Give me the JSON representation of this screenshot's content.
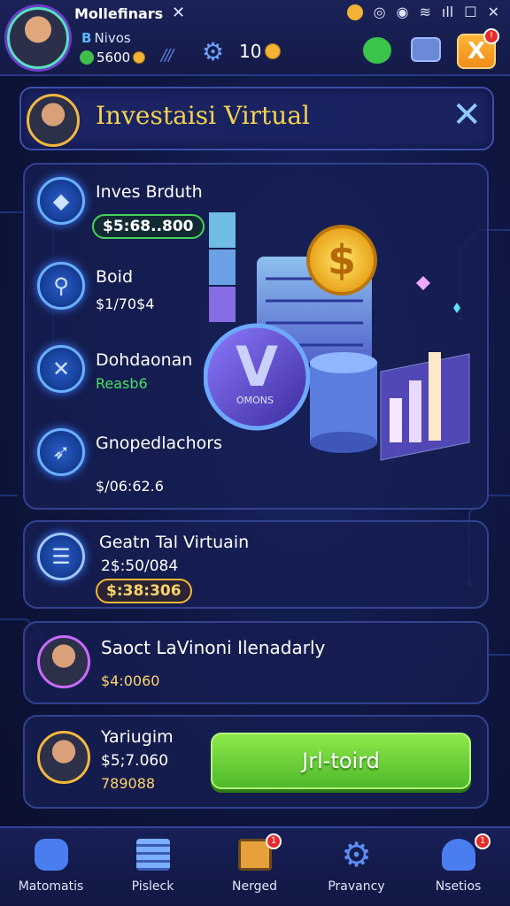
{
  "topbar": {
    "title": "Mollefinars",
    "close": "✕",
    "subtitle_prefix": "B",
    "subtitle": "Nivos",
    "money": "5600",
    "count": "10",
    "gift_label": "X",
    "gift_badge": "!"
  },
  "header": {
    "title": "Investaisi Virtual",
    "close": "✕"
  },
  "investments": [
    {
      "name": "Inves Brduth",
      "value": "$5:68..800",
      "style": "pill-green"
    },
    {
      "name": "Boid",
      "value": "$1/70$4",
      "style": "plain"
    },
    {
      "name": "Dohdaonan",
      "value": "Reasb6",
      "style": "green"
    },
    {
      "name": "Gnopedlachors",
      "value": "$/06:62.6",
      "style": "plain"
    }
  ],
  "illustration": {
    "coin_text": "OMONS"
  },
  "gestn": {
    "title": "Geatn Tal Virtuain",
    "value": "2$:50/084",
    "pill": "$:38:306"
  },
  "social": {
    "title": "Saoct LaVinoni Ilenadarly",
    "value": "$4:0060"
  },
  "yari": {
    "name": "Yariugim",
    "value": "$5;7.060",
    "sub": "789088",
    "button": "Jrl-toird"
  },
  "nav": [
    {
      "label": "Matomatis",
      "icon": "robot-icon"
    },
    {
      "label": "Pisleck",
      "icon": "stack-icon"
    },
    {
      "label": "Nerged",
      "icon": "box-icon",
      "badge": "1"
    },
    {
      "label": "Pravancy",
      "icon": "gear-icon"
    },
    {
      "label": "Nsetios",
      "icon": "bell-icon",
      "badge": "1"
    }
  ],
  "colors": {
    "accent_gold": "#f4d24f",
    "accent_green": "#46e062",
    "bg": "#0f1743"
  }
}
